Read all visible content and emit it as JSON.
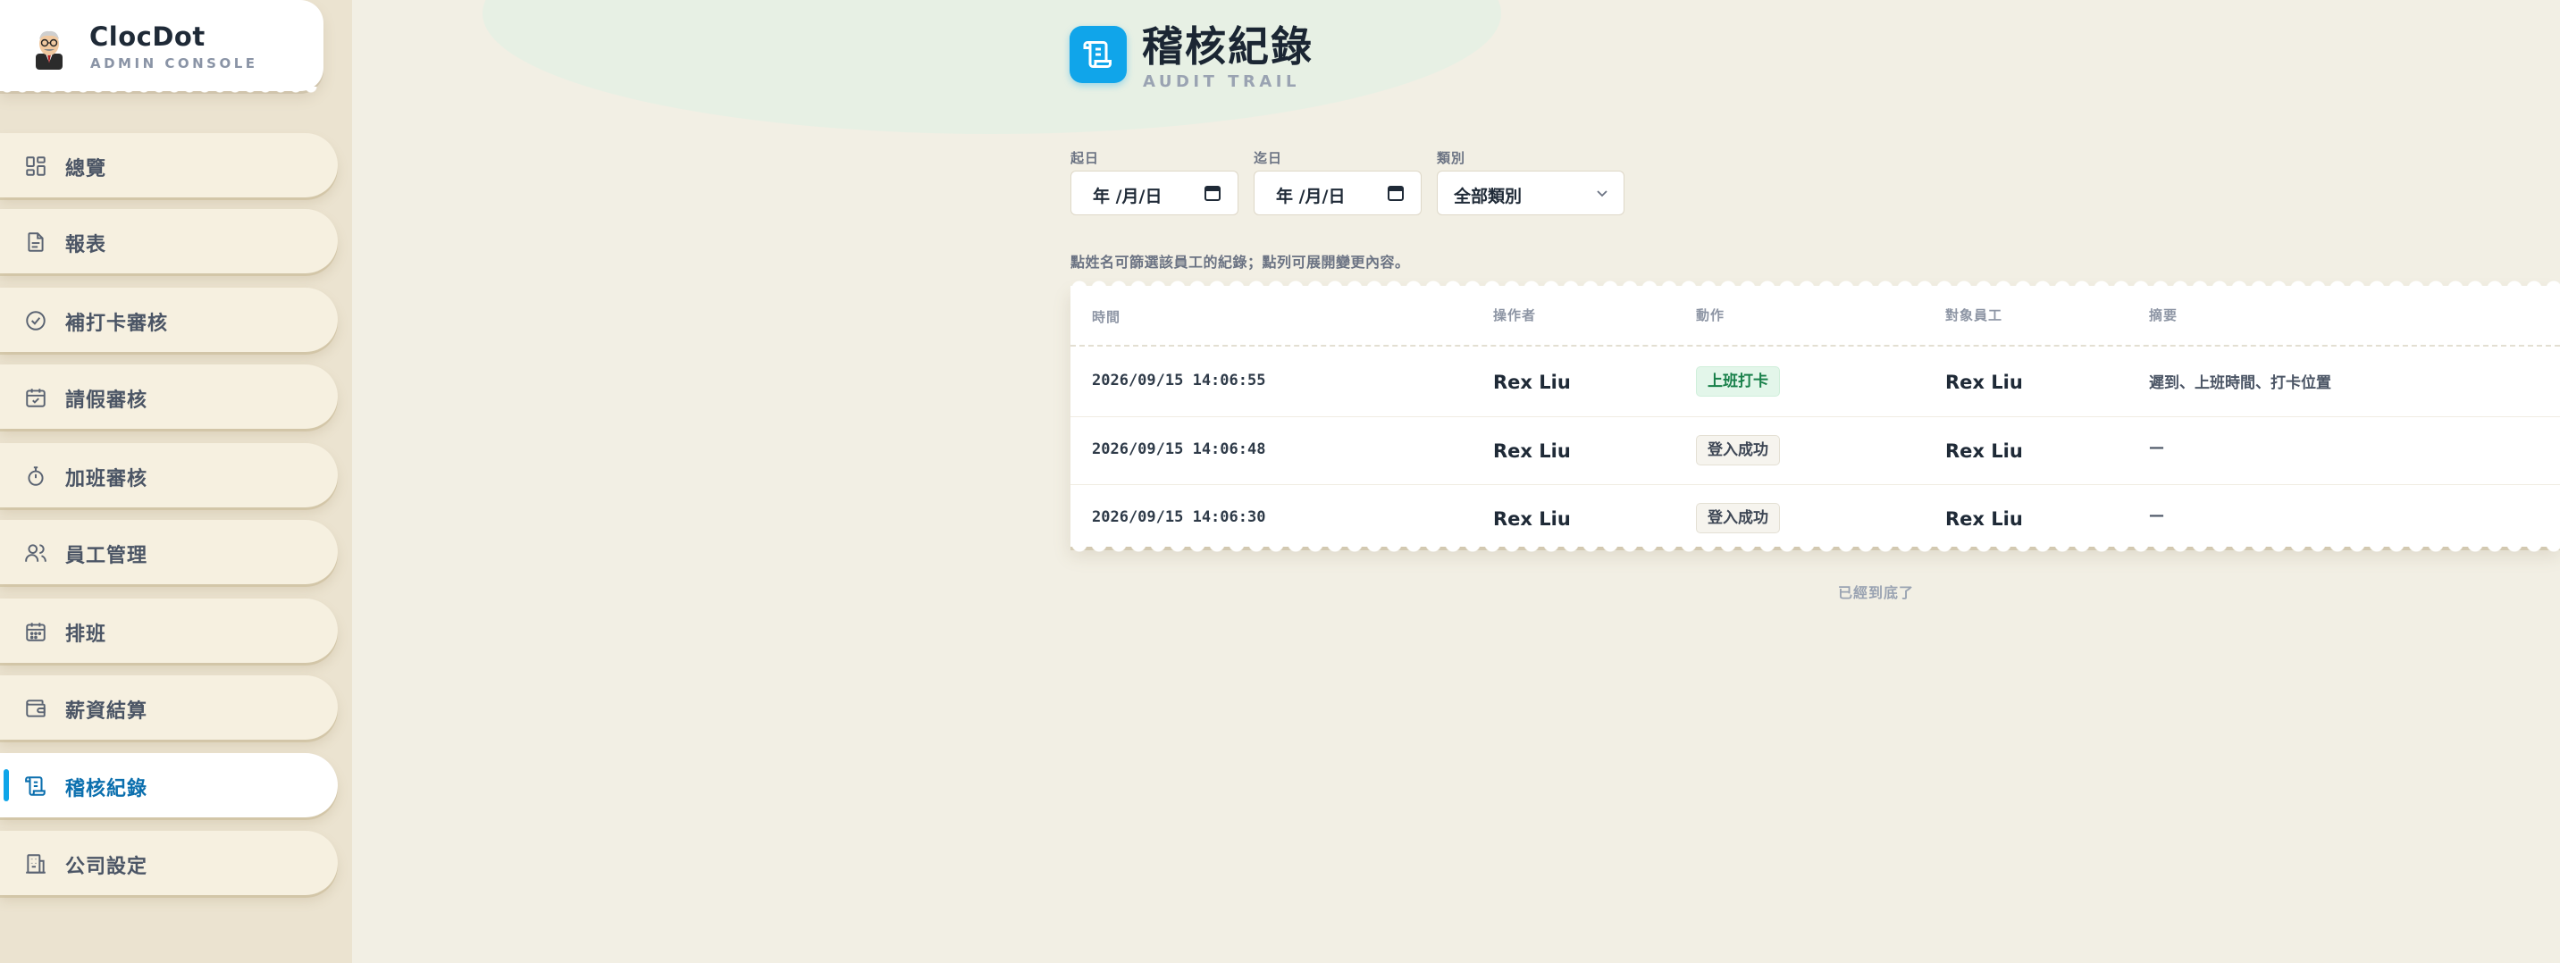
{
  "brand": {
    "name": "ClocDot",
    "subtitle": "ADMIN CONSOLE"
  },
  "sidebar": {
    "items": [
      {
        "label": "總覽",
        "icon": "dashboard-icon"
      },
      {
        "label": "報表",
        "icon": "report-icon"
      },
      {
        "label": "補打卡審核",
        "icon": "check-circle-icon"
      },
      {
        "label": "請假審核",
        "icon": "calendar-check-icon"
      },
      {
        "label": "加班審核",
        "icon": "stopwatch-icon"
      },
      {
        "label": "員工管理",
        "icon": "users-icon"
      },
      {
        "label": "排班",
        "icon": "calendar-icon"
      },
      {
        "label": "薪資結算",
        "icon": "wallet-icon"
      },
      {
        "label": "稽核紀錄",
        "icon": "scroll-icon",
        "active": true
      },
      {
        "label": "公司設定",
        "icon": "building-icon"
      }
    ]
  },
  "page": {
    "title": "稽核紀錄",
    "subtitle": "AUDIT TRAIL"
  },
  "filters": {
    "start_label": "起日",
    "start_value": "年 /月/日",
    "end_label": "迄日",
    "end_value": "年 /月/日",
    "type_label": "類別",
    "type_value": "全部類別"
  },
  "hint": "點姓名可篩選該員工的紀錄；點列可展開變更內容。",
  "table": {
    "headers": {
      "time": "時間",
      "operator": "操作者",
      "action": "動作",
      "target": "對象員工",
      "summary": "摘要"
    },
    "rows": [
      {
        "time": "2026/09/15 14:06:55",
        "operator": "Rex Liu",
        "action": "上班打卡",
        "target": "Rex Liu",
        "summary": "遲到、上班時間、打卡位置"
      },
      {
        "time": "2026/09/15 14:06:48",
        "operator": "Rex Liu",
        "action": "登入成功",
        "target": "Rex Liu",
        "summary": "—"
      },
      {
        "time": "2026/09/15 14:06:30",
        "operator": "Rex Liu",
        "action": "登入成功",
        "target": "Rex Liu",
        "summary": "—"
      }
    ]
  },
  "end_text": "已經到底了",
  "colors": {
    "accent": "#0ea5e9",
    "background": "#f2efe4",
    "sidebar": "#ebe3d0",
    "badge_green": "#18804a"
  }
}
